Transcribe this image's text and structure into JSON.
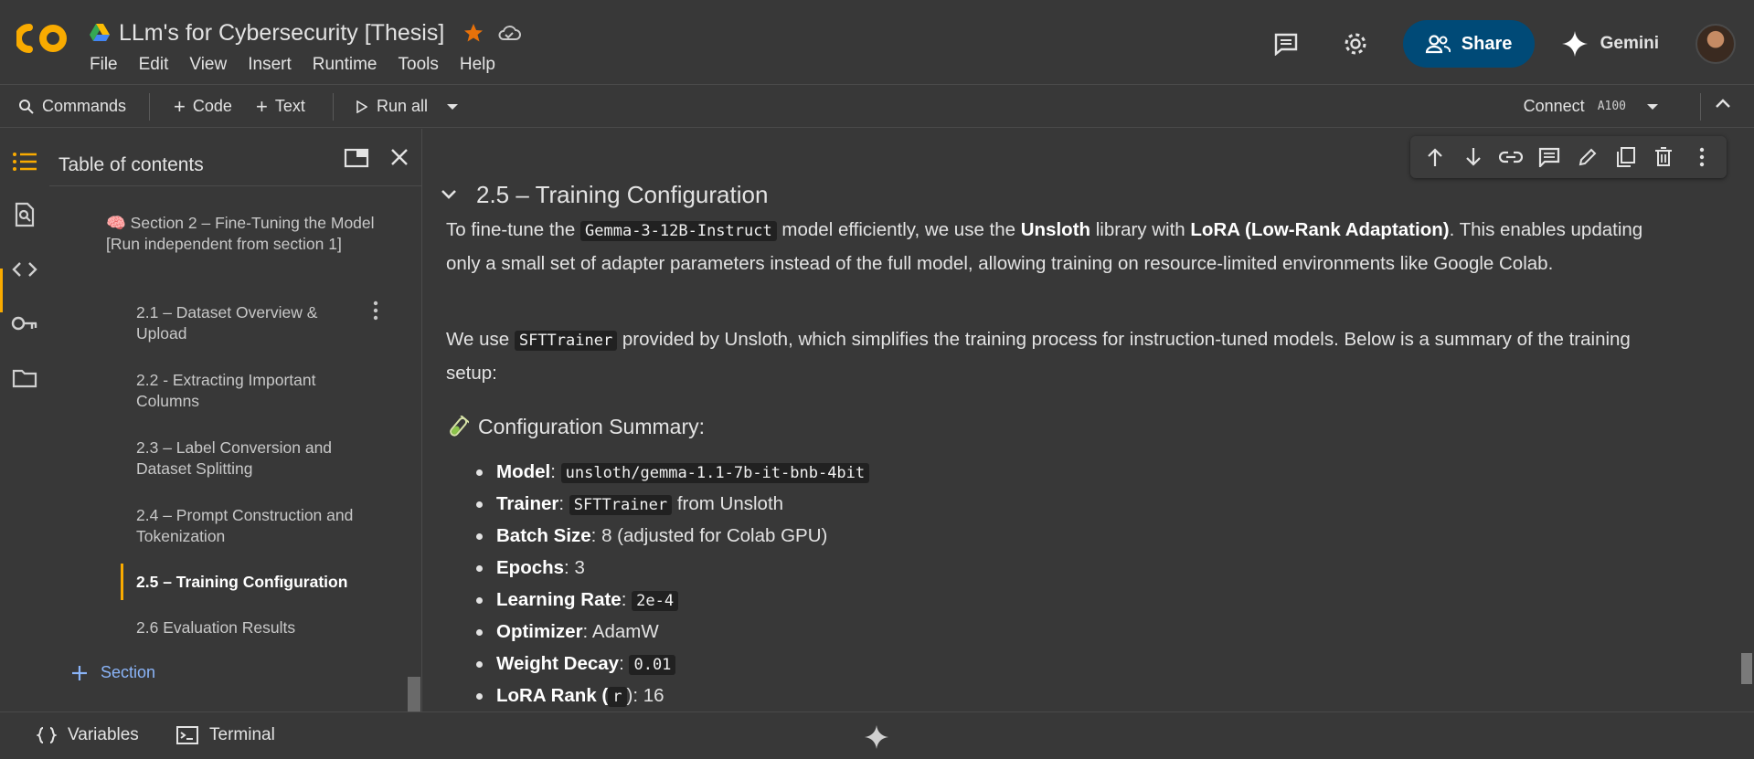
{
  "app": {
    "title": "LLm's for Cybersecurity [Thesis]",
    "menu": [
      "File",
      "Edit",
      "View",
      "Insert",
      "Runtime",
      "Tools",
      "Help"
    ],
    "share_label": "Share",
    "gemini_label": "Gemini",
    "brand_color": "#f9ab00"
  },
  "toolbar": {
    "commands": "Commands",
    "add_code": "Code",
    "add_text": "Text",
    "run_all": "Run all",
    "connect": "Connect",
    "gpu": "A100"
  },
  "toc": {
    "title": "Table of contents",
    "section2": {
      "emoji": "🧠",
      "label": "Section 2 – Fine-Tuning the Model [Run independent from section 1]"
    },
    "items": [
      {
        "label": "2.1 – Dataset Overview & Upload"
      },
      {
        "label": "2.2 - Extracting Important Columns"
      },
      {
        "label": "2.3 – Label Conversion and Dataset Splitting"
      },
      {
        "label": "2.4 – Prompt Construction and Tokenization"
      },
      {
        "label": "2.5 – Training Configuration"
      },
      {
        "label": "2.6 Evaluation Results"
      }
    ],
    "active_index": 4,
    "add_section": "Section"
  },
  "cell": {
    "heading": "2.5 – Training Configuration",
    "p1": {
      "t1": "To fine-tune the ",
      "code1": "Gemma-3-12B-Instruct",
      "t2": " model efficiently, we use the ",
      "b1": "Unsloth",
      "t3": " library with ",
      "b2": "LoRA (Low-Rank Adaptation)",
      "t4": ". This enables updating only a small set of adapter parameters instead of the full model, allowing training on resource-limited environments like Google Colab."
    },
    "p2": {
      "t1": "We use ",
      "code1": "SFTTrainer",
      "t2": " provided by Unsloth, which simplifies the training process for instruction-tuned models. Below is a summary of the training setup:"
    },
    "summary_heading": "Configuration Summary:",
    "bullets": [
      {
        "key": "Model",
        "sep": ": ",
        "code": "unsloth/gemma-1.1-7b-it-bnb-4bit",
        "text": ""
      },
      {
        "key": "Trainer",
        "sep": ": ",
        "code": "SFTTrainer",
        "text": " from Unsloth"
      },
      {
        "key": "Batch Size",
        "sep": ": ",
        "code": "",
        "text": "8 (adjusted for Colab GPU)"
      },
      {
        "key": "Epochs",
        "sep": ": ",
        "code": "",
        "text": "3"
      },
      {
        "key": "Learning Rate",
        "sep": ": ",
        "code": "2e-4",
        "text": ""
      },
      {
        "key": "Optimizer",
        "sep": ": ",
        "code": "",
        "text": "AdamW"
      },
      {
        "key": "Weight Decay",
        "sep": ": ",
        "code": "0.01",
        "text": ""
      },
      {
        "key": "LoRA Rank (",
        "sep": "",
        "code": "r",
        "text": "): 16"
      }
    ]
  },
  "statusbar": {
    "variables": "Variables",
    "terminal": "Terminal"
  }
}
